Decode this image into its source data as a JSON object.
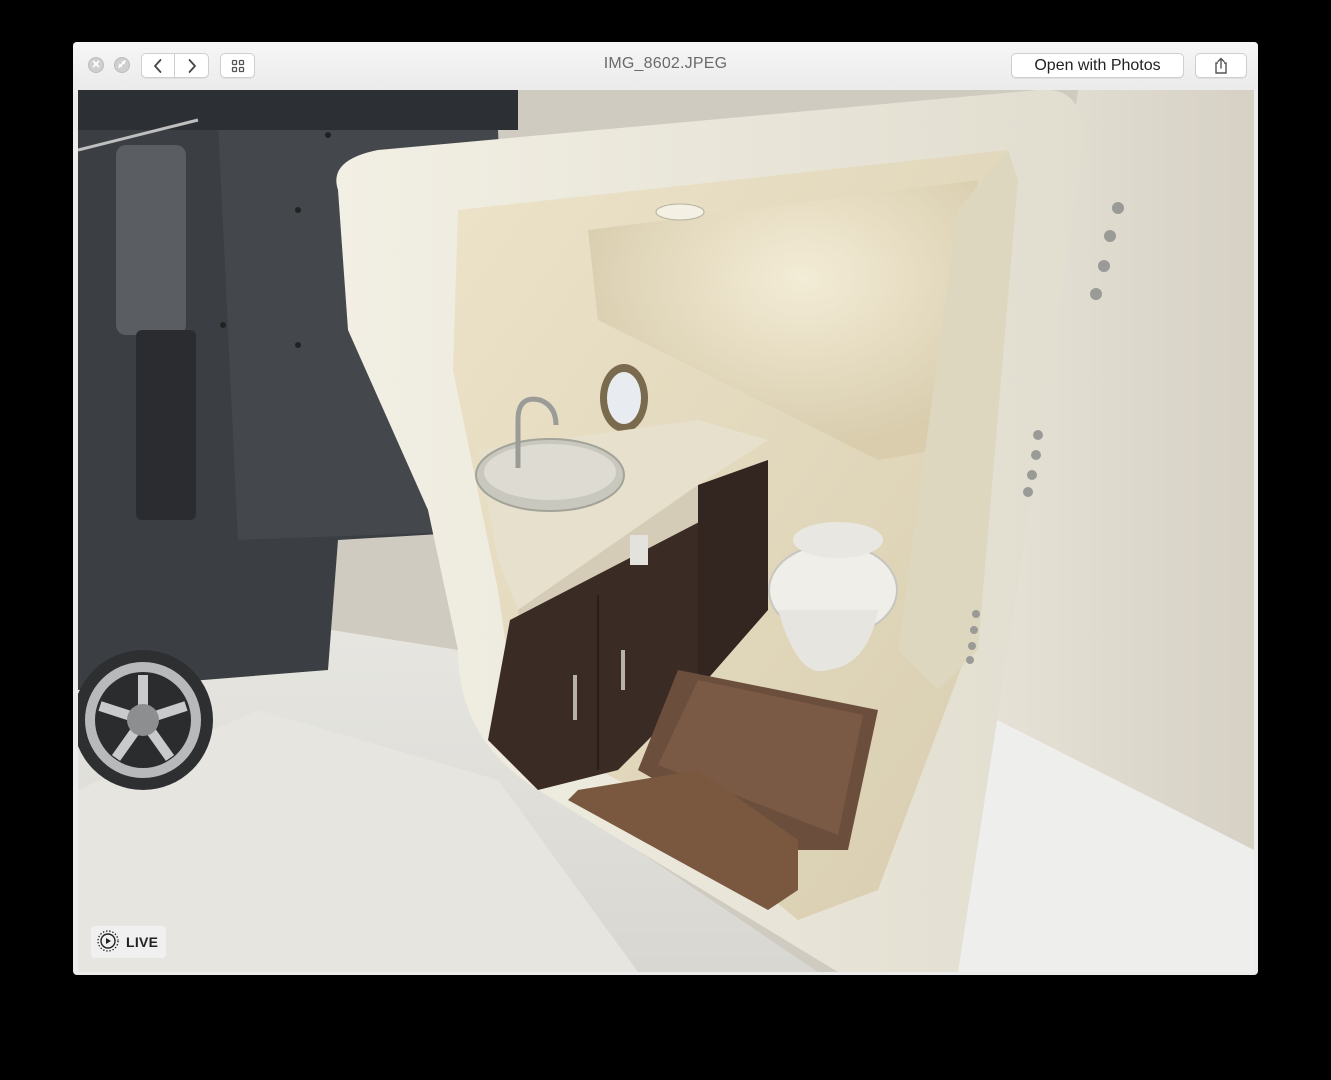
{
  "window": {
    "title": "IMG_8602.JPEG",
    "open_with_label": "Open with Photos"
  },
  "icons": {
    "close": "close-icon",
    "fullscreen": "fullscreen-icon",
    "back": "chevron-left-icon",
    "forward": "chevron-right-icon",
    "grid": "grid-icon",
    "share": "share-icon",
    "live": "live-photo-icon"
  },
  "photo": {
    "badge_label": "LIVE",
    "subject": "boat cabin head compartment with vessel sink and toilet"
  },
  "colors": {
    "window_bg": "#ececec",
    "backdrop": "#000000",
    "titlebar": "#f2f2f2"
  }
}
